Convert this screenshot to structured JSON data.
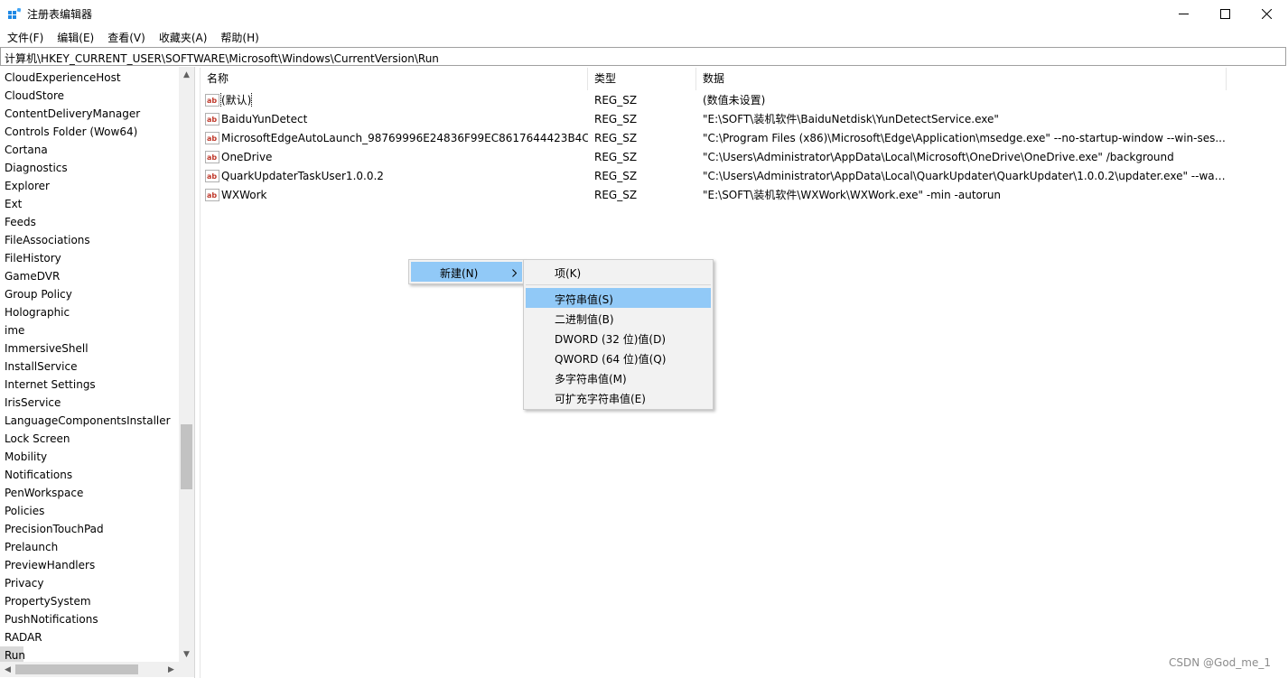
{
  "window": {
    "title": "注册表编辑器",
    "minimize_glyph": "—",
    "maximize_glyph": "☐",
    "close_glyph": "✕"
  },
  "menubar": [
    "文件(F)",
    "编辑(E)",
    "查看(V)",
    "收藏夹(A)",
    "帮助(H)"
  ],
  "address": "计算机\\HKEY_CURRENT_USER\\SOFTWARE\\Microsoft\\Windows\\CurrentVersion\\Run",
  "tree": {
    "items": [
      "CloudExperienceHost",
      "CloudStore",
      "ContentDeliveryManager",
      "Controls Folder (Wow64)",
      "Cortana",
      "Diagnostics",
      "Explorer",
      "Ext",
      "Feeds",
      "FileAssociations",
      "FileHistory",
      "GameDVR",
      "Group Policy",
      "Holographic",
      "ime",
      "ImmersiveShell",
      "InstallService",
      "Internet Settings",
      "IrisService",
      "LanguageComponentsInstaller",
      "Lock Screen",
      "Mobility",
      "Notifications",
      "PenWorkspace",
      "Policies",
      "PrecisionTouchPad",
      "Prelaunch",
      "PreviewHandlers",
      "Privacy",
      "PropertySystem",
      "PushNotifications",
      "RADAR",
      "Run"
    ],
    "selected": "Run",
    "scroll_up": "▲",
    "scroll_down": "▼",
    "scroll_left": "◀",
    "scroll_right": "▶"
  },
  "list": {
    "columns": [
      "名称",
      "类型",
      "数据"
    ],
    "rows": [
      {
        "name": "(默认)",
        "type": "REG_SZ",
        "data": "(数值未设置)"
      },
      {
        "name": "BaiduYunDetect",
        "type": "REG_SZ",
        "data": "\"E:\\SOFT\\装机软件\\BaiduNetdisk\\YunDetectService.exe\""
      },
      {
        "name": "MicrosoftEdgeAutoLaunch_98769996E24836F99EC8617644423B4C",
        "type": "REG_SZ",
        "data": "\"C:\\Program Files (x86)\\Microsoft\\Edge\\Application\\msedge.exe\" --no-startup-window --win-ses..."
      },
      {
        "name": "OneDrive",
        "type": "REG_SZ",
        "data": "\"C:\\Users\\Administrator\\AppData\\Local\\Microsoft\\OneDrive\\OneDrive.exe\" /background"
      },
      {
        "name": "QuarkUpdaterTaskUser1.0.0.2",
        "type": "REG_SZ",
        "data": "\"C:\\Users\\Administrator\\AppData\\Local\\QuarkUpdater\\QuarkUpdater\\1.0.0.2\\updater.exe\" --wak..."
      },
      {
        "name": "WXWork",
        "type": "REG_SZ",
        "data": "\"E:\\SOFT\\装机软件\\WXWork\\WXWork.exe\" -min -autorun"
      }
    ]
  },
  "context_menu": {
    "item": "新建(N)",
    "arrow": "›"
  },
  "submenu": {
    "items": [
      "项(K)",
      "字符串值(S)",
      "二进制值(B)",
      "DWORD (32 位)值(D)",
      "QWORD (64 位)值(Q)",
      "多字符串值(M)",
      "可扩充字符串值(E)"
    ],
    "highlighted": "字符串值(S)"
  },
  "watermark": "CSDN @God_me_1",
  "colors": {
    "highlight": "#91c9f7",
    "menu_bg": "#f2f2f2",
    "icon_red": "#c0392b"
  }
}
